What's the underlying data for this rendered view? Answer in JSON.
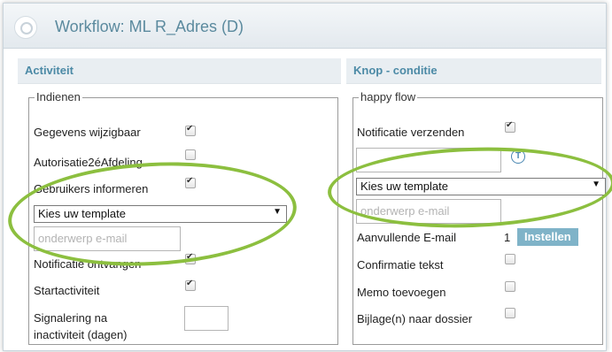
{
  "window": {
    "title": "Workflow: ML R_Adres (D)"
  },
  "left": {
    "header": "Activiteit",
    "group_label": "Indienen",
    "rows": [
      {
        "label": "Gegevens wijzigbaar",
        "checked": true
      },
      {
        "label": "Autorisatie2éAfdeling",
        "checked": false
      },
      {
        "label": "Gebruikers informeren",
        "checked": true
      },
      {
        "label": "Notificatie ontvangen",
        "checked": true
      },
      {
        "label": "Startactiviteit",
        "checked": true
      }
    ],
    "template_select": "Kies uw template",
    "subject_placeholder": "onderwerp e-mail",
    "signalering_line1": "Signalering na",
    "signalering_line2": "inactiviteit (dagen)"
  },
  "right": {
    "header": "Knop - conditie",
    "group_label": "happy flow",
    "notif_label": "Notificatie verzenden",
    "notif_checked": true,
    "info_icon": "T",
    "template_select": "Kies uw template",
    "subject_placeholder": "onderwerp e-mail",
    "extra_email_label": "Aanvullende E-mail",
    "extra_email_count": "1",
    "install_button": "Instellen",
    "rows": [
      {
        "label": "Confirmatie tekst",
        "checked": false
      },
      {
        "label": "Memo toevoegen",
        "checked": false
      },
      {
        "label": "Bijlage(n) naar dossier",
        "checked": false
      }
    ]
  },
  "colors": {
    "accent": "#4c8aa6",
    "highlight": "#8cbf3f",
    "button": "#7fb3c8"
  }
}
